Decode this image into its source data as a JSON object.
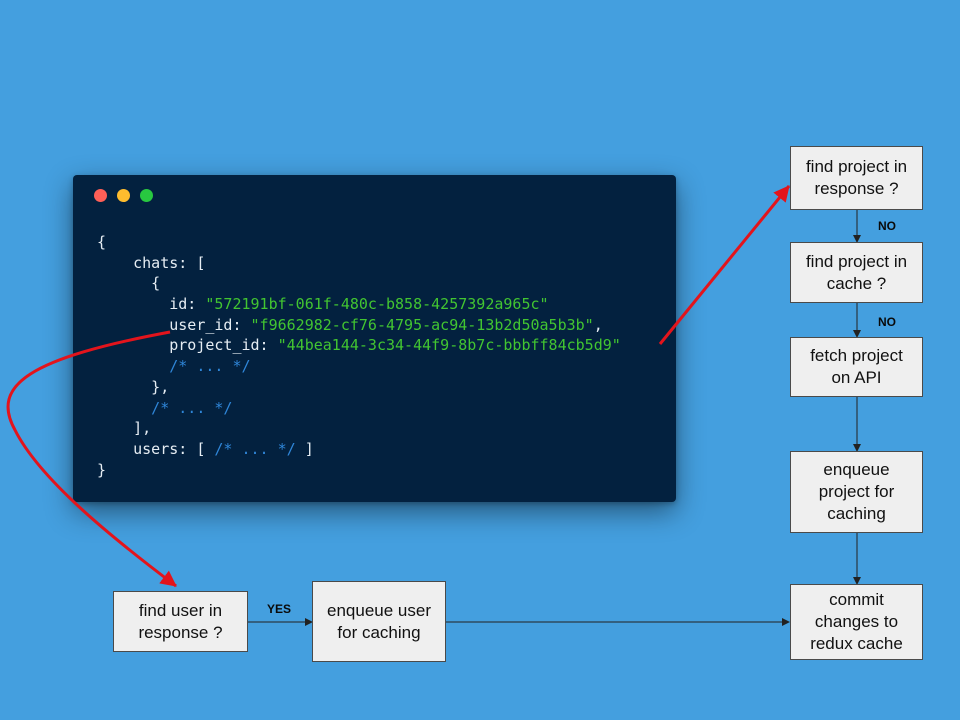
{
  "code": {
    "lines": [
      [
        {
          "t": "{",
          "c": "p"
        }
      ],
      [
        {
          "t": "    chats: [",
          "c": "p"
        }
      ],
      [
        {
          "t": "      {",
          "c": "p"
        }
      ],
      [
        {
          "t": "        id: ",
          "c": "p"
        },
        {
          "t": "\"572191bf-061f-480c-b858-4257392a965c\"",
          "c": "s"
        }
      ],
      [
        {
          "t": "        user_id: ",
          "c": "p"
        },
        {
          "t": "\"f9662982-cf76-4795-ac94-13b2d50a5b3b\"",
          "c": "s"
        },
        {
          "t": ",",
          "c": "p"
        }
      ],
      [
        {
          "t": "        project_id: ",
          "c": "p"
        },
        {
          "t": "\"44bea144-3c34-44f9-8b7c-bbbff84cb5d9\"",
          "c": "s"
        }
      ],
      [
        {
          "t": "        /* ... */",
          "c": "c"
        }
      ],
      [
        {
          "t": "      },",
          "c": "p"
        }
      ],
      [
        {
          "t": "      /* ... */",
          "c": "c"
        }
      ],
      [
        {
          "t": "    ],",
          "c": "p"
        }
      ],
      [
        {
          "t": "    users: [ ",
          "c": "p"
        },
        {
          "t": "/* ... */",
          "c": "c"
        },
        {
          "t": " ]",
          "c": "p"
        }
      ],
      [
        {
          "t": "}",
          "c": "p"
        }
      ]
    ]
  },
  "flow": {
    "find_project_in_response": "find project in\nresponse ?",
    "find_project_in_cache": "find project in\ncache ?",
    "fetch_project_on_api": "fetch project\non API",
    "enqueue_project_for_caching": "enqueue\nproject for\ncaching",
    "commit_changes": "commit\nchanges to\nredux cache",
    "find_user_in_response": "find user in\nresponse ?",
    "enqueue_user_for_caching": "enqueue user\nfor caching",
    "label_no_1": "NO",
    "label_no_2": "NO",
    "label_yes": "YES"
  },
  "colors": {
    "background": "#449fdf",
    "code_bg": "#03213f",
    "string": "#42c531",
    "comment": "#2f86d8",
    "pointer_arrow": "#e3141c"
  }
}
